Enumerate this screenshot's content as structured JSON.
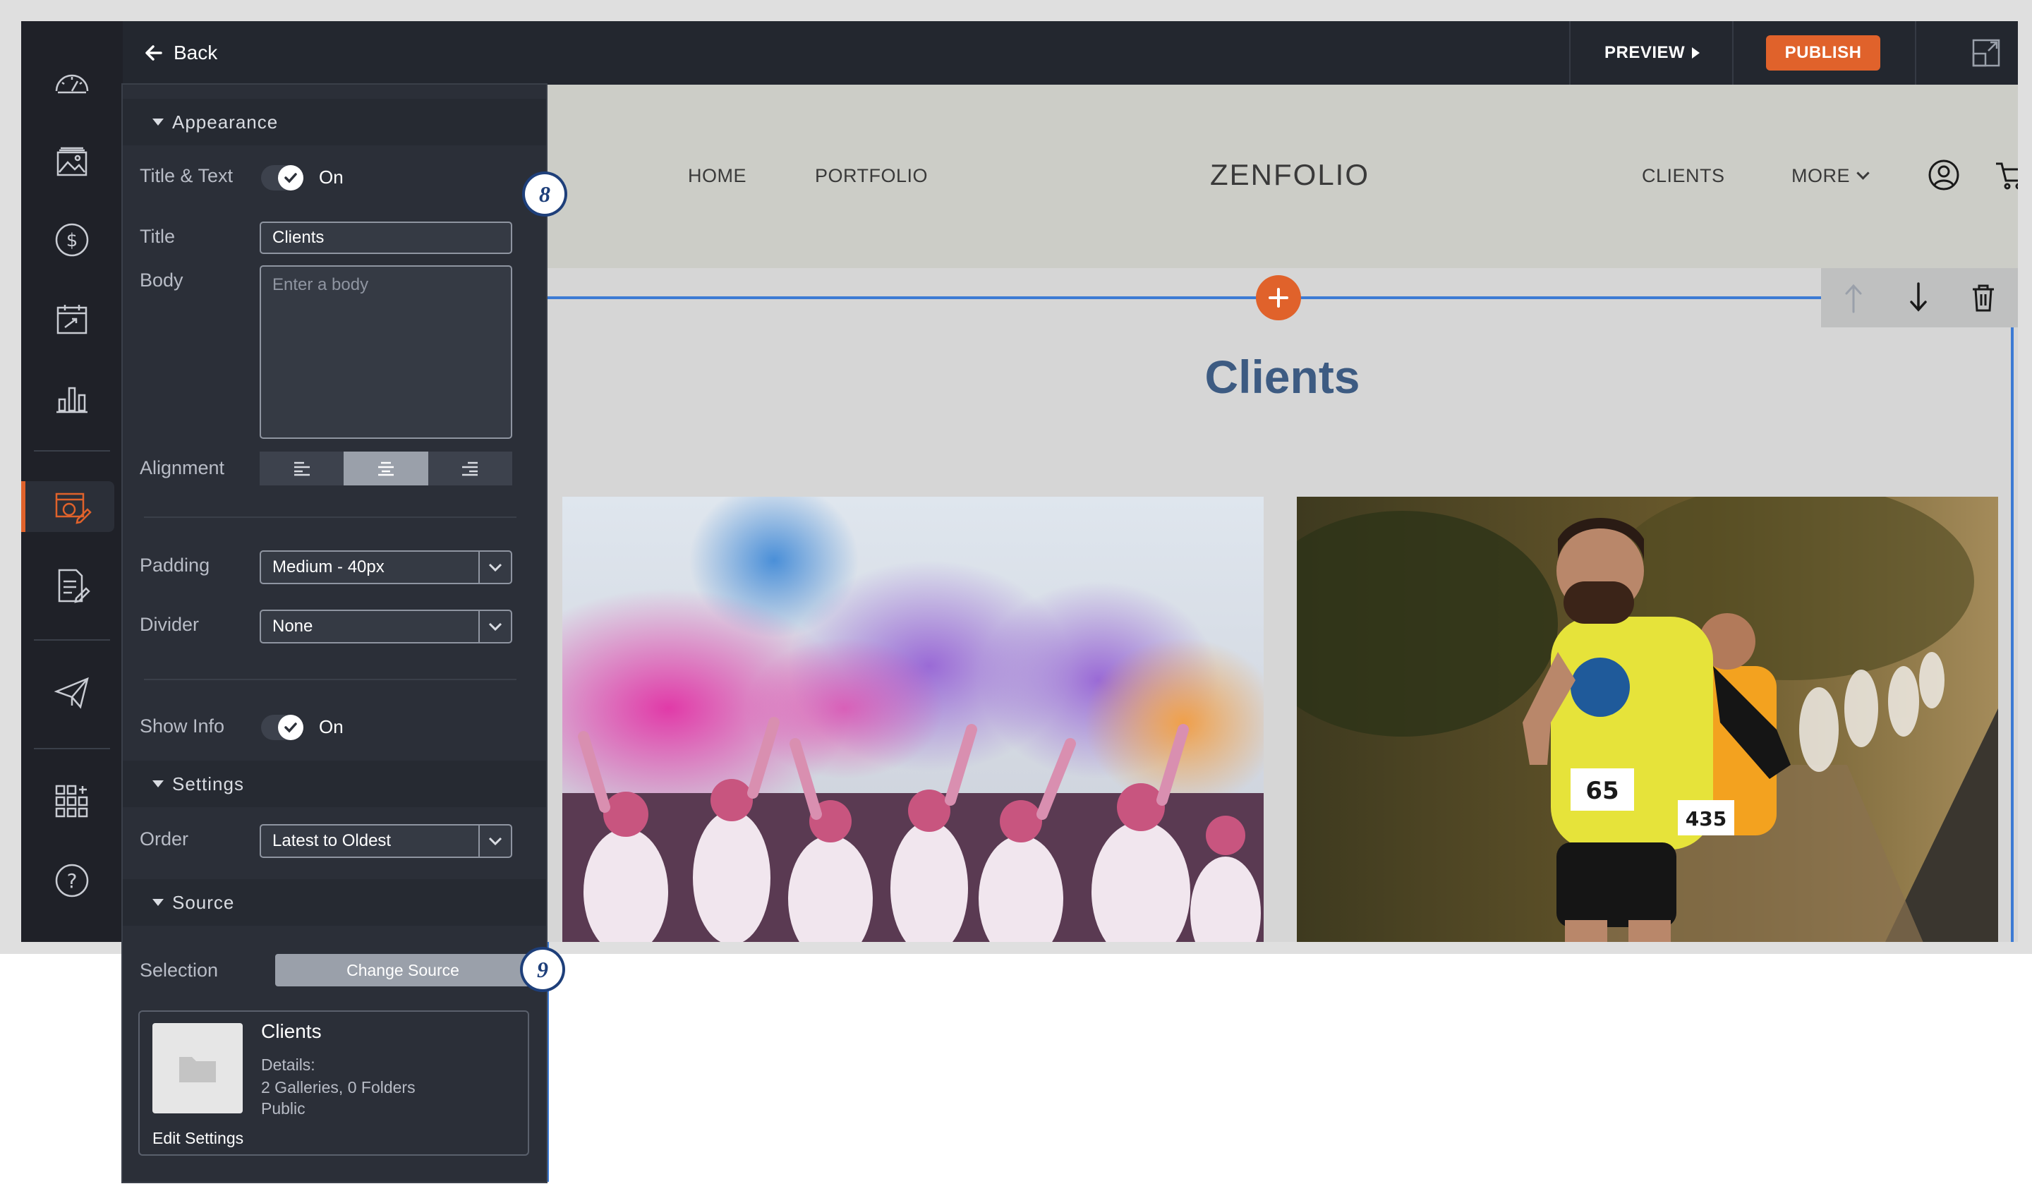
{
  "topbar": {
    "back_label": "Back",
    "preview_label": "PREVIEW",
    "publish_label": "PUBLISH"
  },
  "panel": {
    "appearance": {
      "heading": "Appearance",
      "title_text_label": "Title & Text",
      "title_text_toggle": "On",
      "title_label": "Title",
      "title_value": "Clients",
      "body_label": "Body",
      "body_placeholder": "Enter a body",
      "alignment_label": "Alignment",
      "padding_label": "Padding",
      "padding_value": "Medium - 40px",
      "divider_label": "Divider",
      "divider_value": "None",
      "show_info_label": "Show Info",
      "show_info_toggle": "On"
    },
    "settings": {
      "heading": "Settings",
      "order_label": "Order",
      "order_value": "Latest to Oldest"
    },
    "source": {
      "heading": "Source",
      "selection_label": "Selection",
      "change_source_label": "Change Source",
      "card_title": "Clients",
      "details_label": "Details:",
      "details_counts": "2 Galleries, 0 Folders",
      "visibility": "Public",
      "edit_settings_label": "Edit Settings"
    }
  },
  "badges": {
    "step_8": "8",
    "step_9": "9"
  },
  "site": {
    "nav_home": "HOME",
    "nav_portfolio": "PORTFOLIO",
    "logo": "ZENFOLIO",
    "nav_clients": "CLIENTS",
    "nav_more": "MORE",
    "page_title": "Clients"
  },
  "rail_icons": [
    "dashboard-gauge-icon",
    "gallery-image-icon",
    "dollar-icon",
    "calendar-icon",
    "bar-chart-icon",
    "website-editor-icon",
    "blog-edit-icon",
    "send-paper-plane-icon",
    "apps-grid-icon",
    "help-question-icon"
  ],
  "colors": {
    "accent": "#e0622b",
    "selection": "#3d7bd4",
    "title": "#3d5b82"
  }
}
